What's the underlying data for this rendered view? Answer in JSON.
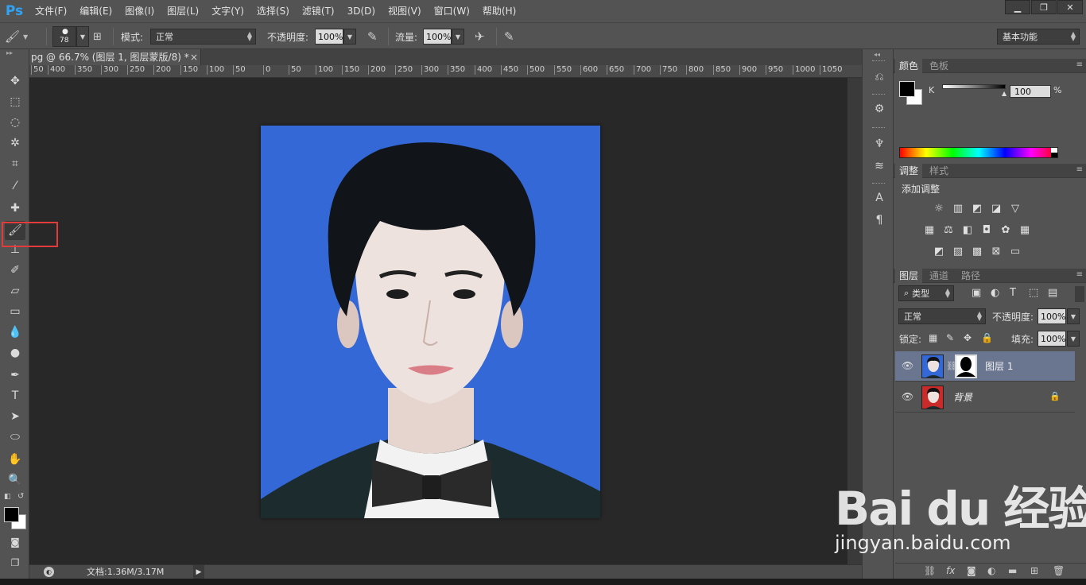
{
  "app": {
    "logo": "Ps",
    "menu": [
      "文件(F)",
      "编辑(E)",
      "图像(I)",
      "图层(L)",
      "文字(Y)",
      "选择(S)",
      "滤镜(T)",
      "3D(D)",
      "视图(V)",
      "窗口(W)",
      "帮助(H)"
    ],
    "window_controls": [
      "minimize-icon",
      "restore-icon",
      "close-icon"
    ]
  },
  "options_bar": {
    "brush_size": "78",
    "mode_label": "模式:",
    "mode_value": "正常",
    "opacity_label": "不透明度:",
    "opacity_value": "100%",
    "flow_label": "流量:",
    "flow_value": "100%",
    "workspace": "基本功能"
  },
  "document": {
    "tab_title": "pg @ 66.7% (图层 1, 图层蒙版/8) *",
    "close": "×",
    "ruler_ticks": [
      "50",
      "400",
      "350",
      "300",
      "250",
      "200",
      "150",
      "100",
      "50",
      "0",
      "50",
      "100",
      "150",
      "200",
      "250",
      "300",
      "350",
      "400",
      "450",
      "500",
      "550",
      "600",
      "650",
      "700",
      "750",
      "800",
      "850",
      "900",
      "950",
      "1000",
      "1050"
    ],
    "photo_bg_color": "#3468d6"
  },
  "status": {
    "doc_size": "文档:1.36M/3.17M"
  },
  "color_panel": {
    "tabs": [
      "颜色",
      "色板"
    ],
    "channel_label": "K",
    "channel_value": "100",
    "unit": "%"
  },
  "adjustments_panel": {
    "tabs": [
      "调整",
      "样式"
    ],
    "title": "添加调整",
    "icons_row1": [
      "brightness-icon",
      "levels-icon",
      "curves-icon",
      "exposure-icon",
      "vibrance-icon"
    ],
    "icons_row2": [
      "hue-icon",
      "color-balance-icon",
      "bw-icon",
      "photo-filter-icon",
      "channel-mixer-icon",
      "color-lookup-icon"
    ],
    "icons_row3": [
      "invert-icon",
      "posterize-icon",
      "threshold-icon",
      "selective-color-icon",
      "gradient-map-icon"
    ]
  },
  "layers_panel": {
    "tabs": [
      "图层",
      "通道",
      "路径"
    ],
    "filter_value": "类型",
    "blend_value": "正常",
    "opacity_label": "不透明度:",
    "opacity_value": "100%",
    "lock_label": "锁定:",
    "fill_label": "填充:",
    "fill_value": "100%",
    "layers": [
      {
        "name": "图层 1",
        "selected": true,
        "has_mask": true
      },
      {
        "name": "背景",
        "selected": false,
        "locked": true
      }
    ]
  },
  "watermark": {
    "logo": "Bai du 经验",
    "url": "jingyan.baidu.com"
  }
}
